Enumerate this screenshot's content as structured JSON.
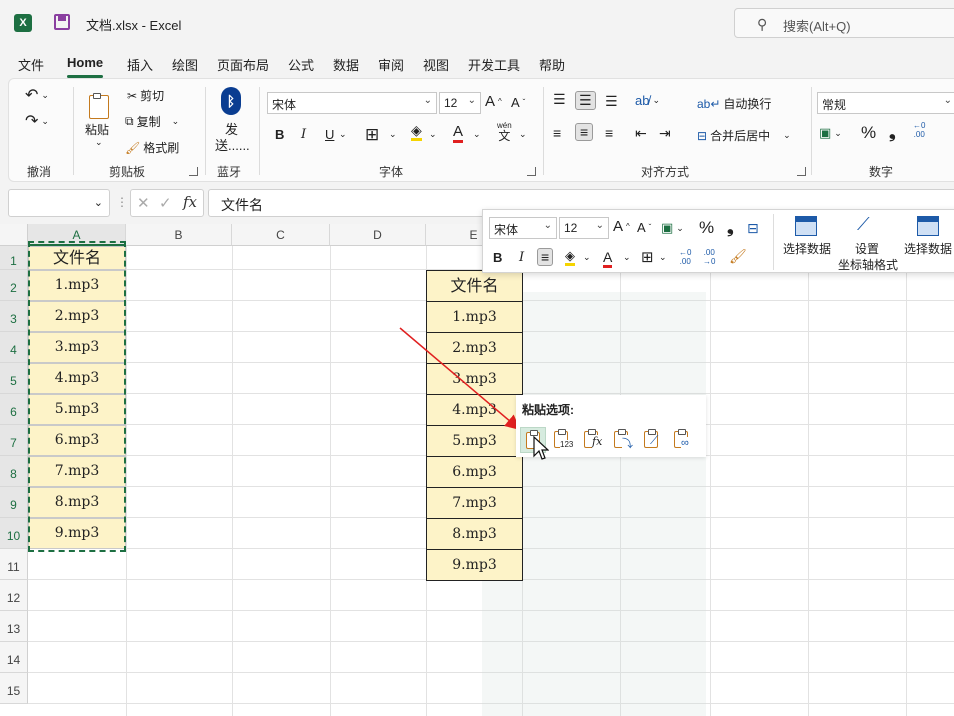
{
  "window": {
    "title": "文档.xlsx  -  Excel",
    "search_placeholder": "搜索(Alt+Q)",
    "app_badge": "X"
  },
  "menu": {
    "tabs": [
      "文件",
      "Home",
      "插入",
      "绘图",
      "页面布局",
      "公式",
      "数据",
      "审阅",
      "视图",
      "开发工具",
      "帮助"
    ],
    "active": "Home"
  },
  "ribbon": {
    "groups": {
      "undo": "撤消",
      "clipboard": "剪贴板",
      "bluetooth": "蓝牙",
      "font": "字体",
      "align": "对齐方式",
      "number": "数字"
    },
    "clipboard": {
      "paste": "粘贴",
      "cut": "剪切",
      "copy": "复制",
      "format_painter": "格式刷"
    },
    "bluetooth": {
      "send_line1": "发",
      "send_line2": "送......"
    },
    "font": {
      "name": "宋体",
      "size": "12",
      "bold": "B",
      "italic": "I",
      "underline": "U",
      "wen": "wén",
      "wen_char": "文"
    },
    "align": {
      "wrap": "自动换行",
      "merge": "合并后居中"
    },
    "number": {
      "format": "常规",
      "percent": "%",
      "comma": "❟",
      "inc_dec_top": "←0",
      "inc_dec_bottom": ".00"
    }
  },
  "formula_bar": {
    "name_box": "",
    "content": "文件名",
    "fx": "fx"
  },
  "grid": {
    "columns": [
      "A",
      "B",
      "C",
      "D",
      "E"
    ],
    "rows": [
      "1",
      "2",
      "3",
      "4",
      "5",
      "6",
      "7",
      "8",
      "9",
      "10",
      "11",
      "12",
      "13",
      "14",
      "15"
    ],
    "source_cells": [
      "文件名",
      "1.mp3",
      "2.mp3",
      "3.mp3",
      "4.mp3",
      "5.mp3",
      "6.mp3",
      "7.mp3",
      "8.mp3",
      "9.mp3"
    ],
    "pasted_cells": [
      "文件名",
      "1.mp3",
      "2.mp3",
      "3.mp3",
      "4.mp3",
      "5.mp3",
      "6.mp3",
      "7.mp3",
      "8.mp3",
      "9.mp3"
    ]
  },
  "mini_toolbar": {
    "font": "宋体",
    "size": "12",
    "percent": "%",
    "bold": "B",
    "italic": "I",
    "btn_select_data": "选择数据",
    "btn_format_axis_line1": "设置",
    "btn_format_axis_line2": "坐标轴格式",
    "btn_select_data2": "选择数据"
  },
  "paste_options": {
    "title": "粘贴选项:",
    "icons": [
      "paste-icon",
      "paste-values-icon",
      "paste-formulas-icon",
      "paste-transpose-icon",
      "paste-formatting-icon",
      "paste-link-icon"
    ],
    "values_label": "123",
    "formula_label": "fx"
  },
  "colors": {
    "excel_green": "#1d6f42",
    "cell_fill": "#fdf3c8",
    "arrow_red": "#e02020"
  }
}
